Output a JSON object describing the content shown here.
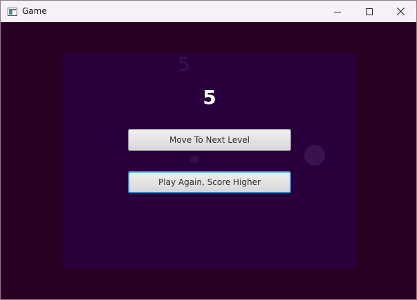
{
  "window": {
    "title": "Game"
  },
  "game": {
    "score": "5",
    "ghost_score": "5",
    "buttons": {
      "next_level": "Move To Next Level",
      "play_again": "Play Again, Score Higher"
    }
  },
  "colors": {
    "background": "#2a0022",
    "panel": "#29003b",
    "focus_border": "#2a8ad4"
  },
  "icons": {
    "app": "window-app-icon",
    "minimize": "minimize-icon",
    "maximize": "maximize-icon",
    "close": "close-icon"
  }
}
